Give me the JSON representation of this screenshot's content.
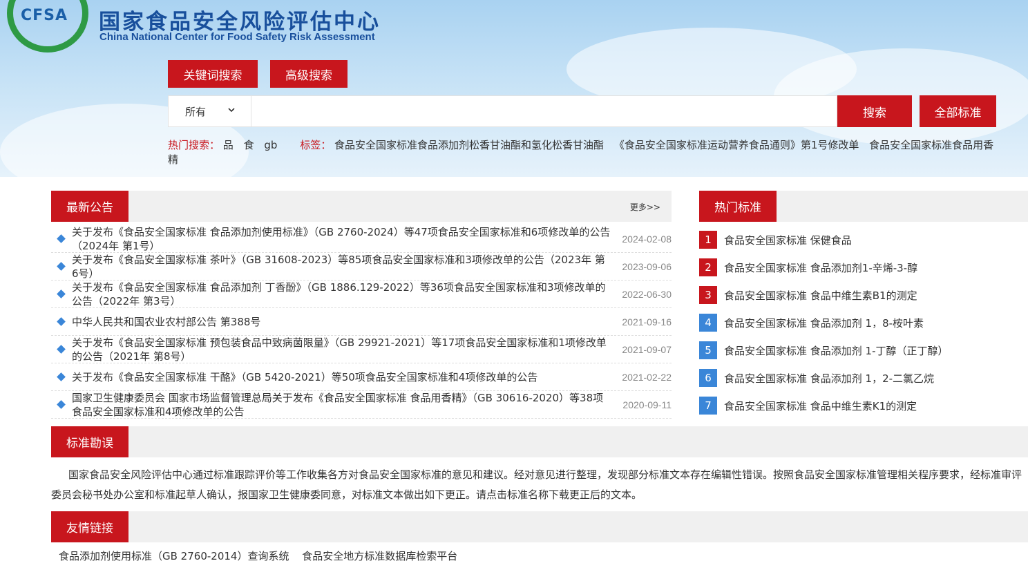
{
  "brand": {
    "logo_text": "CFSA",
    "title": "国家食品安全风险评估中心",
    "subtitle": "China National Center for Food Safety Risk Assessment",
    "colors": {
      "accent_red": "#c8161d",
      "logo_green": "#2e9a45",
      "title_blue": "#184f9c",
      "number_blue": "#3a86d8"
    }
  },
  "search": {
    "tabs": [
      "关键词搜索",
      "高级搜索"
    ],
    "scope_selected": "所有",
    "query": "",
    "search_label": "搜索",
    "all_standards_label": "全部标准",
    "hot_label": "热门搜索：",
    "hot_terms": [
      "品",
      "食",
      "gb"
    ],
    "tags_label": "标签：",
    "tags": [
      "食品安全国家标准食品添加剂松香甘油酯和氢化松香甘油酯",
      "《食品安全国家标准运动营养食品通则》第1号修改单",
      "食品安全国家标准食品用香精"
    ]
  },
  "announcements": {
    "heading": "最新公告",
    "more": "更多>>",
    "items": [
      {
        "title": "关于发布《食品安全国家标准 食品添加剂使用标准》（GB 2760-2024）等47项食品安全国家标准和6项修改单的公告（2024年 第1号）",
        "date": "2024-02-08"
      },
      {
        "title": "关于发布《食品安全国家标准 茶叶》（GB 31608-2023）等85项食品安全国家标准和3项修改单的公告（2023年 第6号）",
        "date": "2023-09-06"
      },
      {
        "title": "关于发布《食品安全国家标准 食品添加剂 丁香酚》（GB 1886.129-2022）等36项食品安全国家标准和3项修改单的公告（2022年 第3号）",
        "date": "2022-06-30"
      },
      {
        "title": "中华人民共和国农业农村部公告 第388号",
        "date": "2021-09-16"
      },
      {
        "title": "关于发布《食品安全国家标准 预包装食品中致病菌限量》（GB 29921-2021）等17项食品安全国家标准和1项修改单的公告（2021年 第8号）",
        "date": "2021-09-07"
      },
      {
        "title": "关于发布《食品安全国家标准 干酪》（GB 5420-2021）等50项食品安全国家标准和4项修改单的公告",
        "date": "2021-02-22"
      },
      {
        "title": "国家卫生健康委员会 国家市场监督管理总局关于发布《食品安全国家标准 食品用香精》（GB 30616-2020）等38项食品安全国家标准和4项修改单的公告",
        "date": "2020-09-11"
      }
    ]
  },
  "hot_standards": {
    "heading": "热门标准",
    "items": [
      {
        "rank": "1",
        "title": "食品安全国家标准 保健食品"
      },
      {
        "rank": "2",
        "title": "食品安全国家标准 食品添加剂1-辛烯-3-醇"
      },
      {
        "rank": "3",
        "title": "食品安全国家标准 食品中维生素B1的测定"
      },
      {
        "rank": "4",
        "title": "食品安全国家标准 食品添加剂 1，8-桉叶素"
      },
      {
        "rank": "5",
        "title": "食品安全国家标准 食品添加剂 1-丁醇（正丁醇）"
      },
      {
        "rank": "6",
        "title": "食品安全国家标准 食品添加剂 1，2-二氯乙烷"
      },
      {
        "rank": "7",
        "title": "食品安全国家标准 食品中维生素K1的测定"
      }
    ]
  },
  "erratum": {
    "heading": "标准勘误",
    "text": "国家食品安全风险评估中心通过标准跟踪评价等工作收集各方对食品安全国家标准的意见和建议。经对意见进行整理，发现部分标准文本存在编辑性错误。按照食品安全国家标准管理相关程序要求，经标准审评委员会秘书处办公室和标准起草人确认，报国家卫生健康委同意，对标准文本做出如下更正。请点击标准名称下载更正后的文本。"
  },
  "links": {
    "heading": "友情链接",
    "items": [
      "食品添加剂使用标准（GB 2760-2014）查询系统",
      "食品安全地方标准数据库检索平台"
    ]
  }
}
